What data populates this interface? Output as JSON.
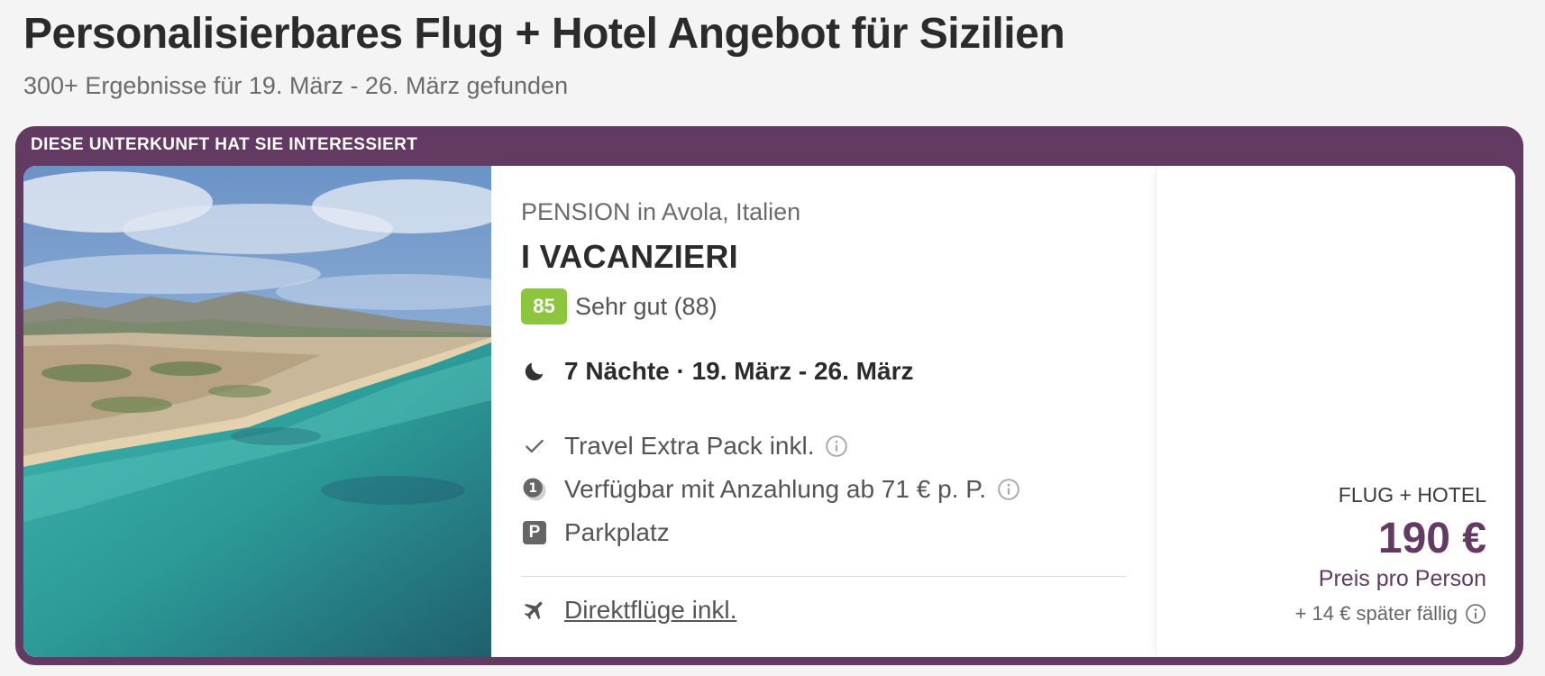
{
  "page": {
    "title": "Personalisierbares Flug + Hotel Angebot für Sizilien",
    "results": "300+ Ergebnisse für 19. März - 26. März gefunden"
  },
  "card": {
    "banner": "DIESE UNTERKUNFT HAT SIE INTERESSIERT",
    "accent_color": "#633a62",
    "type_location": "PENSION in Avola, Italien",
    "name": "I VACANZIERI",
    "rating": {
      "score": "85",
      "text": "Sehr gut (88)",
      "badge_color": "#8cc63f"
    },
    "stay": {
      "icon": "moon-icon",
      "text": "7 Nächte · 19. März - 26. März"
    },
    "features": [
      {
        "icon": "check-icon",
        "text": "Travel Extra Pack inkl.",
        "info": true
      },
      {
        "icon": "deposit-icon",
        "text": "Verfügbar mit Anzahlung ab 71 € p. P.",
        "info": true
      },
      {
        "icon": "parking-icon",
        "text": "Parkplatz",
        "info": false
      }
    ],
    "flight": {
      "icon": "plane-icon",
      "text": "Direktflüge inkl."
    },
    "price": {
      "label": "FLUG + HOTEL",
      "value": "190 €",
      "note": "Preis pro Person",
      "later": "+ 14 € später fällig"
    }
  }
}
